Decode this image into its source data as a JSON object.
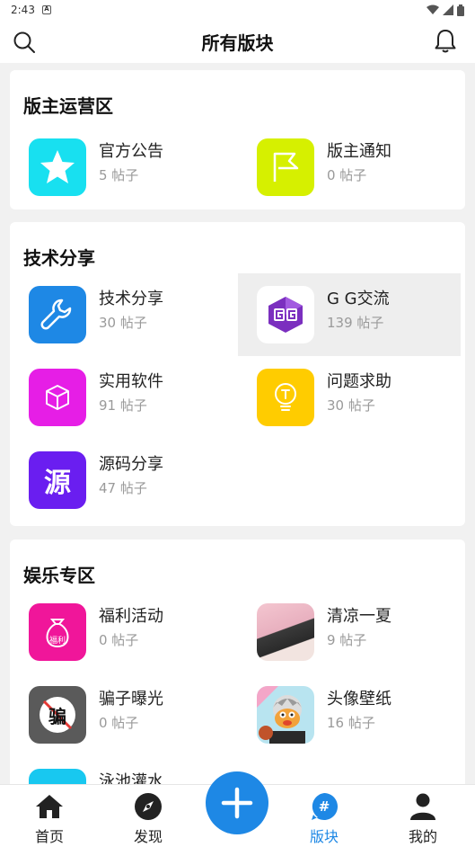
{
  "status": {
    "time": "2:43",
    "notification_icon": "A"
  },
  "header": {
    "title": "所有版块"
  },
  "sections": [
    {
      "title": "版主运营区",
      "items": [
        {
          "name": "官方公告",
          "count": "5 帖子",
          "icon": "star-icon",
          "color": "#18e0f0"
        },
        {
          "name": "版主通知",
          "count": "0 帖子",
          "icon": "flag-icon",
          "color": "#d6f000"
        }
      ]
    },
    {
      "title": "技术分享",
      "items": [
        {
          "name": "技术分享",
          "count": "30 帖子",
          "icon": "wrench-icon",
          "color": "#1e88e5"
        },
        {
          "name": "G G交流",
          "count": "139 帖子",
          "icon": "gg-logo-icon",
          "color": "#ffffff"
        },
        {
          "name": "实用软件",
          "count": "91 帖子",
          "icon": "cube-icon",
          "color": "#e61ee6"
        },
        {
          "name": "问题求助",
          "count": "30 帖子",
          "icon": "lightbulb-icon",
          "color": "#ffcc00"
        },
        {
          "name": "源码分享",
          "count": "47 帖子",
          "icon": "source-icon",
          "icon_text": "源",
          "color": "#6a1ef0"
        }
      ]
    },
    {
      "title": "娱乐专区",
      "items": [
        {
          "name": "福利活动",
          "count": "0 帖子",
          "icon": "gift-bag-icon",
          "icon_text": "福利",
          "color": "#f0169a"
        },
        {
          "name": "清凉一夏",
          "count": "9 帖子",
          "icon": "photo-thumbnail-icon",
          "color": "#e8c8c8"
        },
        {
          "name": "骗子曝光",
          "count": "0 帖子",
          "icon": "no-scam-icon",
          "icon_text": "骗",
          "color": "#5a5a5a"
        },
        {
          "name": "头像壁纸",
          "count": "16 帖子",
          "icon": "avatar-thumbnail-icon",
          "color": "#b8e4f0"
        },
        {
          "name": "泳池灌水",
          "count": "",
          "icon": "pool-icon",
          "color": "#18c8f0"
        }
      ]
    }
  ],
  "nav": [
    {
      "label": "首页",
      "icon": "home-icon"
    },
    {
      "label": "发现",
      "icon": "compass-icon"
    },
    {
      "label": "版块",
      "icon": "hashtag-icon",
      "active": true
    },
    {
      "label": "我的",
      "icon": "person-icon"
    }
  ],
  "colors": {
    "accent": "#1e88e5"
  }
}
